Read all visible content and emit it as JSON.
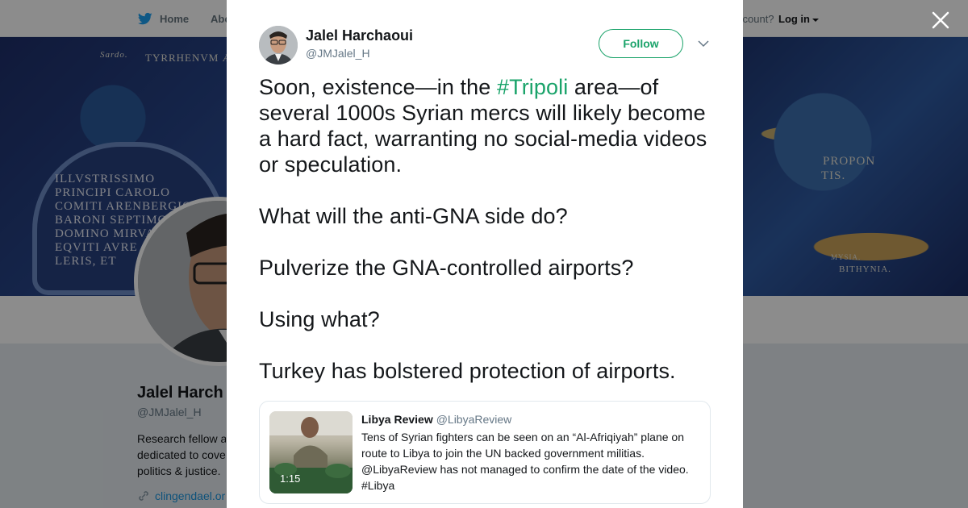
{
  "topnav": {
    "home_label": "Home",
    "about_label": "Abo",
    "account_text": "ccount?",
    "login_label": "Log in"
  },
  "banner": {
    "cartouche_lines": [
      "ILLVSTRISSIMO",
      "PRINCIPI CAROLO",
      "COMITI ARENBERGIO",
      "BARONI SEPTIMON",
      "DOMINO MIRVA",
      "EQVITI AVRE",
      "LERIS, ET"
    ],
    "map_words": {
      "tyrrhenum": "TYRRHENVM Æ",
      "sardo": "Sardo.",
      "propon": "PROPON",
      "tis": "TIS.",
      "bithynia": "BITHYNIA.",
      "mysia": "MYSIA."
    }
  },
  "profile": {
    "name": "Jalel Harch",
    "handle": "@JMJalel_H",
    "bio_lines": [
      "Research fellow a",
      "dedicated to cove",
      "politics & justice."
    ],
    "link": "clingendael.or"
  },
  "tweet": {
    "author_name": "Jalel Harchaoui",
    "author_handle": "@JMJalel_H",
    "follow_label": "Follow",
    "text_before_hashtag": "Soon, existence—in the ",
    "hashtag": "#Tripoli",
    "text_after_hashtag": " area—of several 1000s Syrian mercs will likely become a hard fact, warranting no social-media videos or speculation.",
    "paragraph_2": "What will the anti-GNA side do?",
    "paragraph_3": "Pulverize the GNA-controlled airports?",
    "paragraph_4": "Using what?",
    "paragraph_5": "Turkey has bolstered protection of airports."
  },
  "quoted_tweet": {
    "author_name": "Libya Review",
    "author_handle": "@LibyaReview",
    "text": "Tens of Syrian fighters can be seen on an “Al-Afriqiyah” plane on route to Libya to join the UN backed government militias. @LibyaReview has not managed to confirm the date of the video. #Libya",
    "video_duration": "1:15"
  },
  "colors": {
    "accent_green": "#1aa36a",
    "link_blue": "#1b95e0",
    "text_primary": "#14171a",
    "text_secondary": "#657786"
  }
}
